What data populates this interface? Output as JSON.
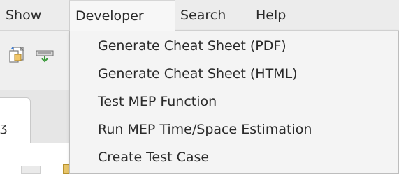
{
  "menubar": {
    "items": [
      {
        "label": "Show"
      },
      {
        "label": "Developer"
      },
      {
        "label": "Search"
      },
      {
        "label": "Help"
      }
    ]
  },
  "toolbar": {
    "icons": [
      "copy-document-icon",
      "network-icon"
    ]
  },
  "editor": {
    "tab_close_glyph": "ʒ"
  },
  "developer_menu": {
    "items": [
      {
        "label": "Generate Cheat Sheet (PDF)"
      },
      {
        "label": "Generate Cheat Sheet (HTML)"
      },
      {
        "label": "Test MEP Function"
      },
      {
        "label": "Run MEP Time/Space Estimation"
      },
      {
        "label": "Create Test Case"
      }
    ]
  },
  "colors": {
    "menubar_bg": "#ececec",
    "dropdown_bg": "#f4f4f4",
    "text": "#2a2a2a"
  }
}
